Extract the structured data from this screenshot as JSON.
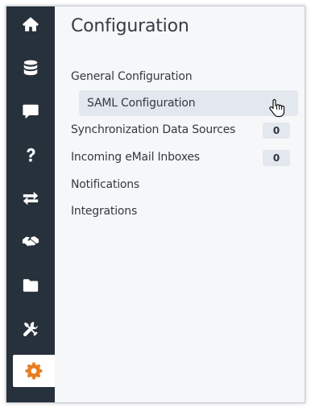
{
  "sidebar": {
    "items": [
      {
        "id": "home",
        "icon": "home-icon"
      },
      {
        "id": "database",
        "icon": "database-icon"
      },
      {
        "id": "chat",
        "icon": "chat-icon"
      },
      {
        "id": "help",
        "icon": "question-icon"
      },
      {
        "id": "sync",
        "icon": "arrows-exchange-icon"
      },
      {
        "id": "handshake",
        "icon": "handshake-icon"
      },
      {
        "id": "folder",
        "icon": "folder-icon"
      },
      {
        "id": "tools",
        "icon": "tools-icon"
      },
      {
        "id": "settings",
        "icon": "gear-icon",
        "active": true
      }
    ],
    "background": "#26313b",
    "active_icon_color": "#e67e22"
  },
  "main": {
    "title": "Configuration",
    "menu": {
      "general": {
        "label": "General Configuration"
      },
      "saml": {
        "label": "SAML Configuration",
        "highlighted": true
      },
      "sync_sources": {
        "label": "Synchronization Data Sources",
        "count": "0"
      },
      "email_inboxes": {
        "label": "Incoming eMail Inboxes",
        "count": "0"
      },
      "notifications": {
        "label": "Notifications"
      },
      "integrations": {
        "label": "Integrations"
      }
    }
  },
  "cursor": {
    "icon": "hand-pointer-icon"
  }
}
